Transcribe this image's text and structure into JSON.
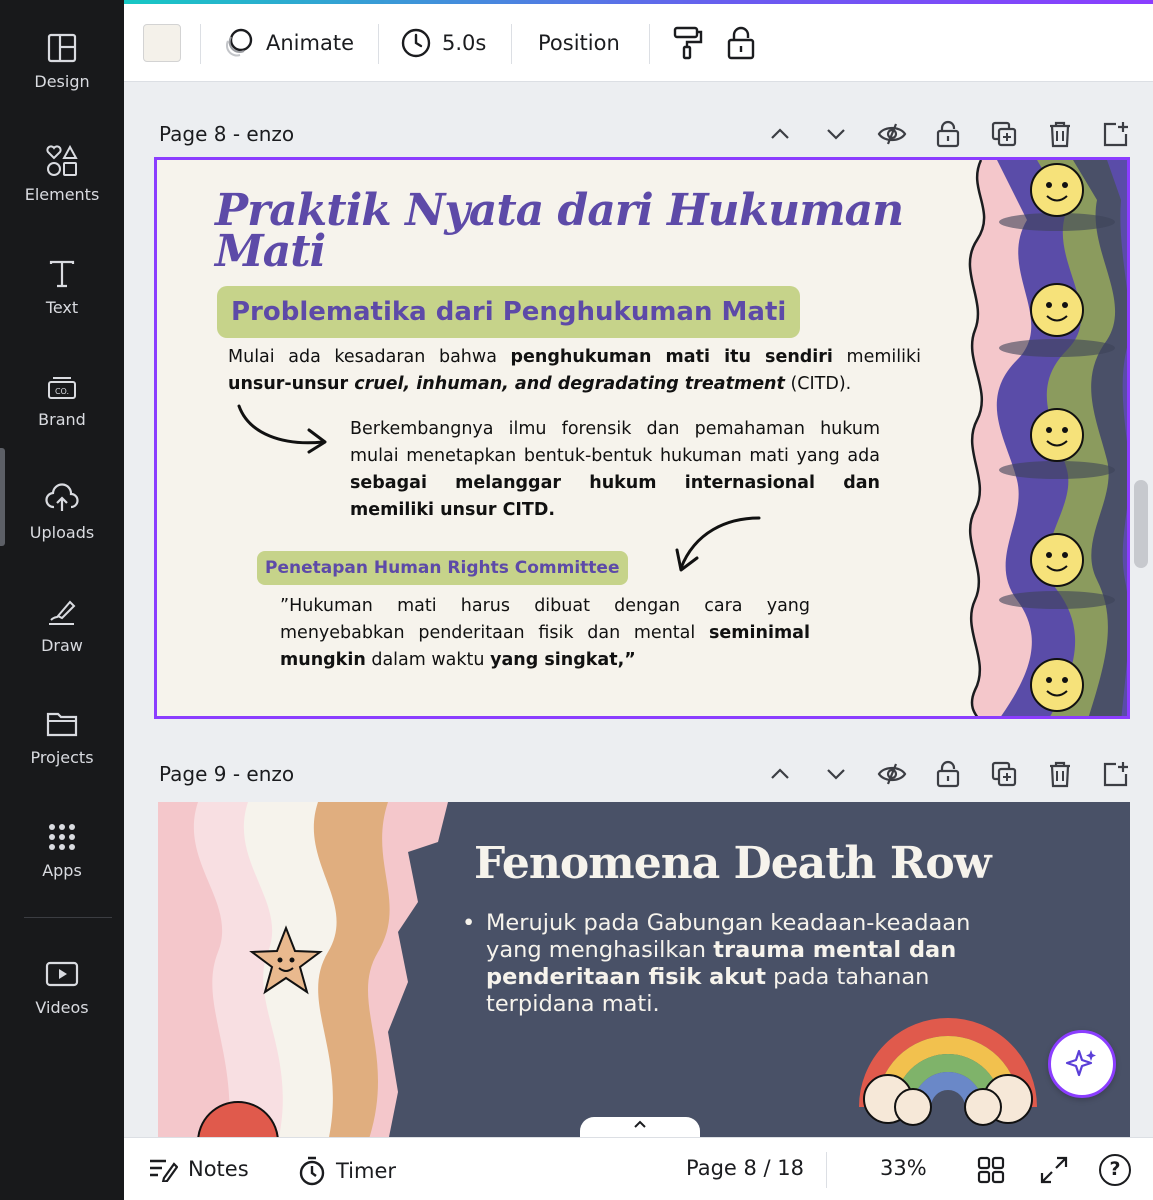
{
  "sidebar": {
    "items": [
      {
        "label": "Design",
        "icon": "layout-icon"
      },
      {
        "label": "Elements",
        "icon": "shapes-icon"
      },
      {
        "label": "Text",
        "icon": "text-icon"
      },
      {
        "label": "Brand",
        "icon": "brand-icon"
      },
      {
        "label": "Uploads",
        "icon": "cloud-upload-icon"
      },
      {
        "label": "Draw",
        "icon": "pen-icon"
      },
      {
        "label": "Projects",
        "icon": "folder-icon"
      },
      {
        "label": "Apps",
        "icon": "grid-icon"
      },
      {
        "label": "Videos",
        "icon": "play-icon"
      }
    ]
  },
  "toolbar": {
    "color_swatch": "#f4f1ea",
    "animate_label": "Animate",
    "duration_label": "5.0s",
    "position_label": "Position"
  },
  "pages": {
    "p8": {
      "header": "Page 8 - enzo",
      "title": "Praktik Nyata dari Hukuman Mati",
      "subtitle": "Problematika dari Penghukuman Mati",
      "para1_a": "Mulai ada kesadaran bahwa ",
      "para1_b": "penghukuman mati itu sendiri",
      "para1_c": " memiliki ",
      "para1_d": "unsur-unsur ",
      "para1_e": "cruel, inhuman, and degradating treatment",
      "para1_f": " (CITD).",
      "para2_a": "Berkembangnya ilmu forensik dan pemahaman hukum mulai menetapkan bentuk-bentuk hukuman mati yang ada ",
      "para2_b": "sebagai melanggar hukum internasional dan memiliki  unsur CITD.",
      "tag": "Penetapan Human Rights Committee",
      "quote_a": "”Hukuman mati harus dibuat dengan cara yang menyebabkan penderitaan fisik dan mental ",
      "quote_b": "seminimal mungkin",
      "quote_c": " dalam waktu ",
      "quote_d": "yang singkat,”"
    },
    "p9": {
      "header": "Page 9 - enzo",
      "title": "Fenomena Death Row",
      "bullet_a": "Merujuk pada Gabungan keadaan-keadaan yang menghasilkan ",
      "bullet_b": "trauma mental dan penderitaan fisik akut",
      "bullet_c": " pada tahanan terpidana mati."
    }
  },
  "bottombar": {
    "notes_label": "Notes",
    "timer_label": "Timer",
    "page_indicator": "Page 8 / 18",
    "zoom": "33%",
    "help": "?"
  }
}
